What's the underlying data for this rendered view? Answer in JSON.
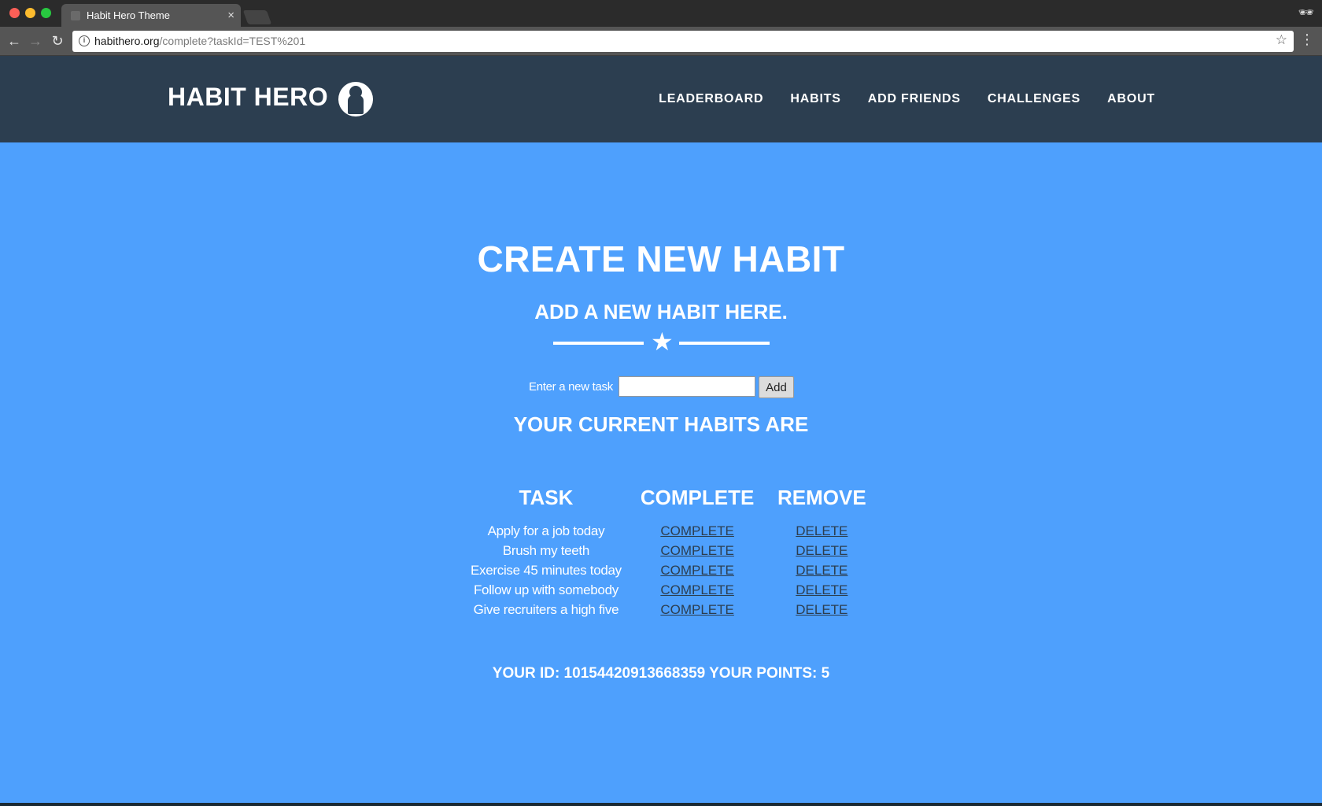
{
  "browser": {
    "tab_title": "Habit Hero Theme",
    "tab_close": "×",
    "url_host": "habithero.org",
    "url_path": "/complete?taskId=TEST%201"
  },
  "header": {
    "logo": "HABIT HERO",
    "nav": [
      "LEADERBOARD",
      "HABITS",
      "ADD FRIENDS",
      "CHALLENGES",
      "ABOUT"
    ]
  },
  "main": {
    "title": "CREATE NEW HABIT",
    "subtitle": "ADD A NEW HABIT HERE.",
    "form": {
      "label": "Enter a new task",
      "input_value": "",
      "button": "Add"
    },
    "habits_heading": "YOUR CURRENT HABITS ARE",
    "table": {
      "headers": [
        "TASK",
        "COMPLETE",
        "REMOVE"
      ],
      "rows": [
        {
          "task": "Apply for a job today",
          "complete": "COMPLETE",
          "remove": "DELETE"
        },
        {
          "task": "Brush my teeth",
          "complete": "COMPLETE",
          "remove": "DELETE"
        },
        {
          "task": "Exercise 45 minutes today",
          "complete": "COMPLETE",
          "remove": "DELETE"
        },
        {
          "task": "Follow up with somebody",
          "complete": "COMPLETE",
          "remove": "DELETE"
        },
        {
          "task": "Give recruiters a high five",
          "complete": "COMPLETE",
          "remove": "DELETE"
        }
      ]
    },
    "footer": "YOUR ID: 10154420913668359 YOUR POINTS: 5"
  },
  "colors": {
    "page_bg": "#4ea0fd",
    "header_bg": "#2c3e50",
    "link": "#2c3e50"
  }
}
